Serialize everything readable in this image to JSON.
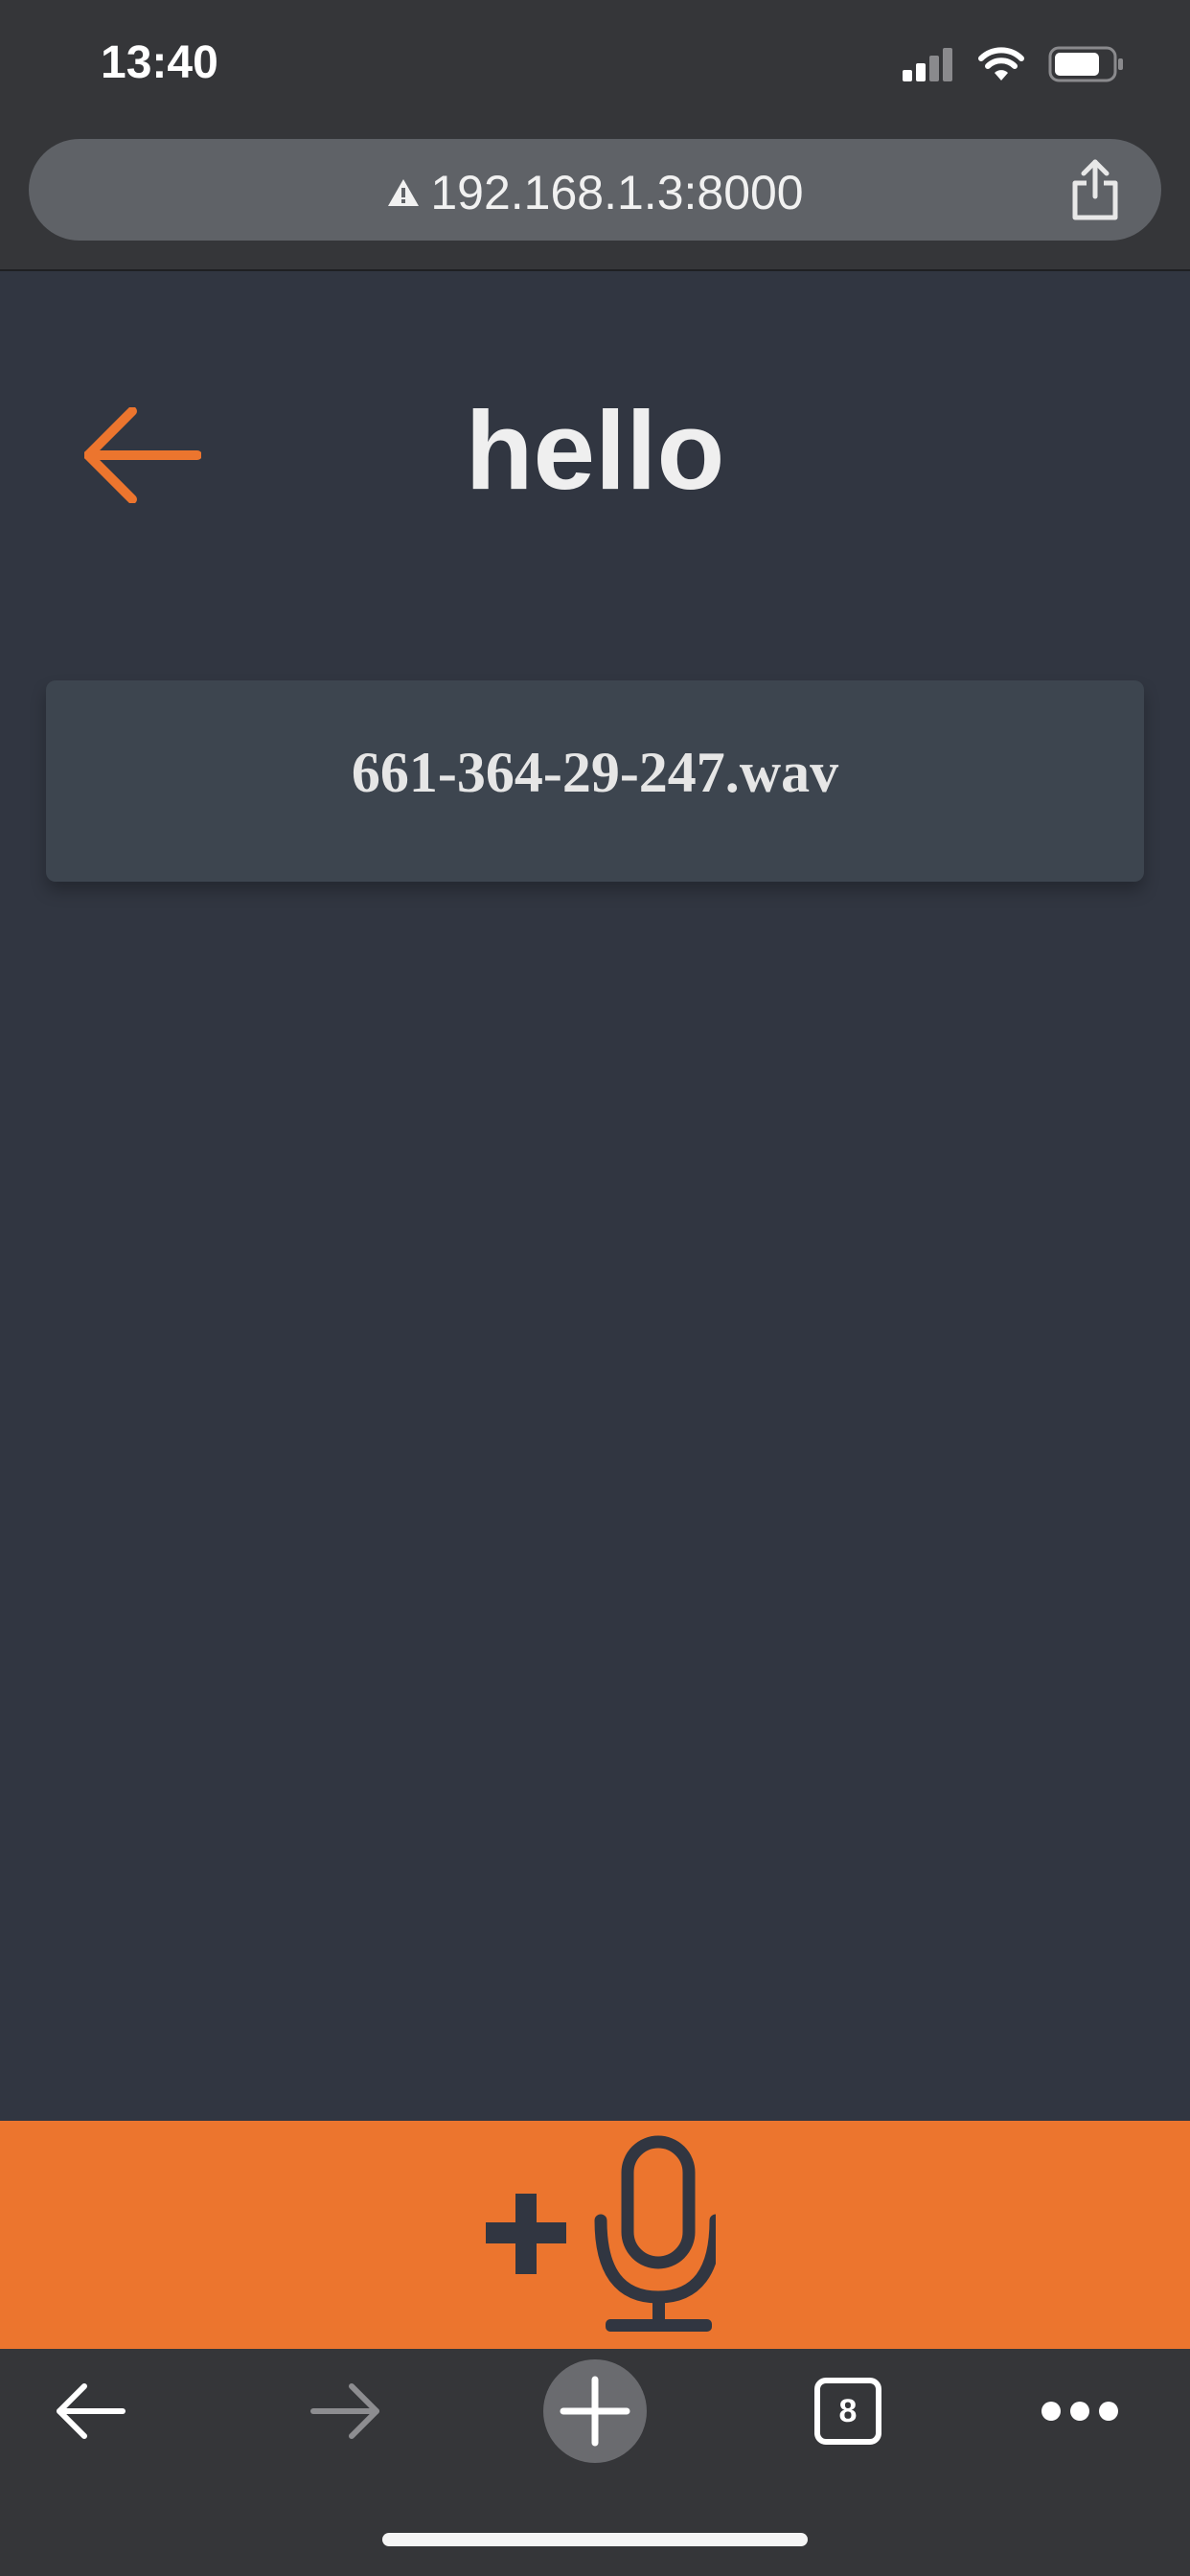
{
  "status_bar": {
    "time": "13:40",
    "icons": [
      "cellular-signal-icon",
      "wifi-icon",
      "battery-icon"
    ]
  },
  "browser": {
    "url": "192.168.1.3:8000",
    "url_icon": "warning-icon",
    "share_icon": "share-icon"
  },
  "page": {
    "back_icon": "back-arrow-icon",
    "title": "hello",
    "files": [
      {
        "name": "661-364-29-247.wav"
      }
    ]
  },
  "record_bar": {
    "icons": [
      "plus-icon",
      "microphone-icon"
    ],
    "background": "#ec752e",
    "icon_color": "#313641"
  },
  "toolbar": {
    "tab_count": "8",
    "icons": [
      "back-icon",
      "forward-icon",
      "new-tab-icon",
      "tabs-icon",
      "more-icon"
    ]
  },
  "colors": {
    "accent": "#ec752e",
    "page_background": "#313641",
    "card_background": "#3d454f",
    "browser_chrome": "#353639"
  }
}
